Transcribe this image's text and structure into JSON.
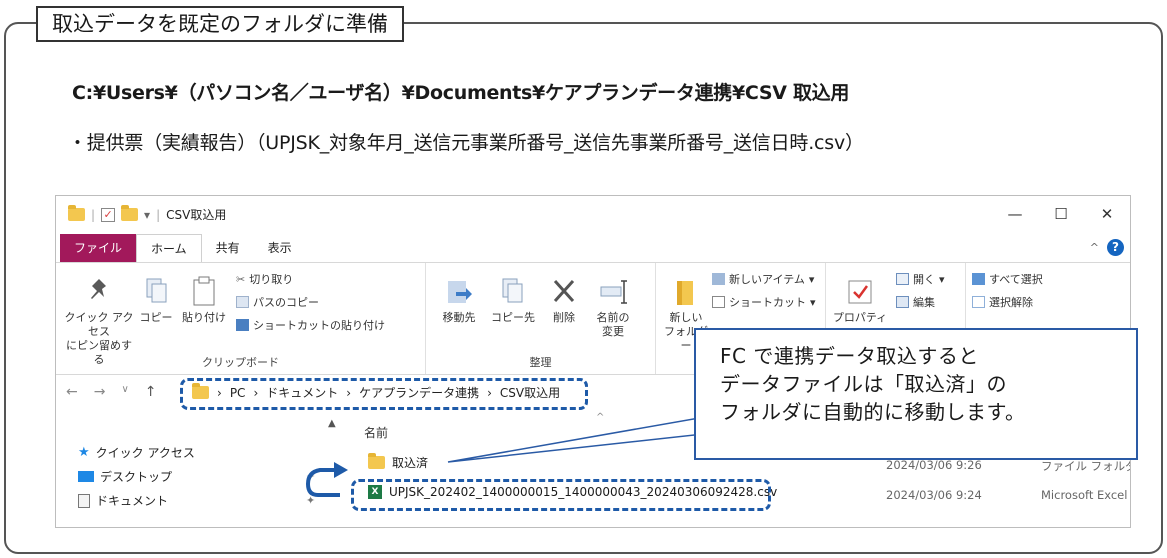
{
  "heading": "取込データを既定のフォルダに準備",
  "folder_path": "C:¥Users¥（パソコン名／ユーザ名）¥Documents¥ケアプランデータ連携¥CSV 取込用",
  "bullet": "・提供票（実績報告）（UPJSK_対象年月_送信元事業所番号_送信先事業所番号_送信日時.csv）",
  "explorer": {
    "title": "CSV取込用",
    "window_controls": [
      "—",
      "☐",
      "✕"
    ],
    "tabs": [
      "ファイル",
      "ホーム",
      "共有",
      "表示"
    ],
    "ribbon": {
      "pin_label_1": "クイック アクセス",
      "pin_label_2": "にピン留めする",
      "copy": "コピー",
      "paste": "貼り付け",
      "cut": "切り取り",
      "copy_path": "パスのコピー",
      "paste_shortcut": "ショートカットの貼り付け",
      "clipboard_group": "クリップボード",
      "move_to": "移動先",
      "copy_to": "コピー先",
      "delete": "削除",
      "rename_1": "名前の",
      "rename_2": "変更",
      "organize_group": "整理",
      "new_1": "新しい",
      "new_2": "フォルダー",
      "new_item": "新しいアイテム",
      "shortcut": "ショートカット",
      "properties": "プロパティ",
      "open": "開く",
      "edit": "編集",
      "select_all": "すべて選択",
      "deselect": "選択解除"
    },
    "address": [
      "PC",
      "ドキュメント",
      "ケアプランデータ連携",
      "CSV取込用"
    ],
    "nav_items": [
      "クイック アクセス",
      "デスクトップ",
      "ドキュメント"
    ],
    "column_name": "名前",
    "files": [
      {
        "name": "取込済",
        "date": "2024/03/06 9:26",
        "type": "ファイル フォルダー"
      },
      {
        "name": "UPJSK_202402_1400000015_1400000043_20240306092428.csv",
        "date": "2024/03/06 9:24",
        "type": "Microsoft Excel CS..."
      }
    ]
  },
  "callout": {
    "line1": "FC で連携データ取込すると",
    "line2": "データファイルは「取込済」の",
    "line3": "フォルダに自動的に移動します。"
  }
}
